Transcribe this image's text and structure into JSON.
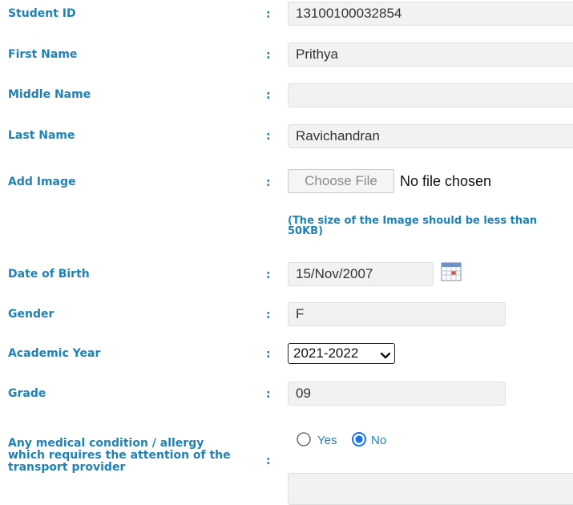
{
  "form": {
    "student_id": {
      "label": "Student ID",
      "value": "13100100032854"
    },
    "first_name": {
      "label": "First Name",
      "value": "Prithya"
    },
    "middle_name": {
      "label": "Middle Name",
      "value": ""
    },
    "last_name": {
      "label": "Last Name",
      "value": "Ravichandran"
    },
    "add_image": {
      "label": "Add Image",
      "button_label": "Choose File",
      "status": "No file chosen",
      "hint": "(The size of the Image should be less than 50KB)"
    },
    "date_of_birth": {
      "label": "Date of Birth",
      "value": "15/Nov/2007",
      "icon": "calendar-icon"
    },
    "gender": {
      "label": "Gender",
      "value": "F"
    },
    "academic_year": {
      "label": "Academic Year",
      "selected": "2021-2022"
    },
    "grade": {
      "label": "Grade",
      "value": "09"
    },
    "medical": {
      "label": "Any medical condition / allergy which requires the attention of the transport provider",
      "options": [
        "Yes",
        "No"
      ],
      "selected": "No",
      "details": ""
    },
    "separator": ":"
  },
  "colors": {
    "label": "#1f82b7",
    "field_bg": "#f2f2f2",
    "field_border": "#dedede",
    "radio_selected": "#1a73e8"
  }
}
